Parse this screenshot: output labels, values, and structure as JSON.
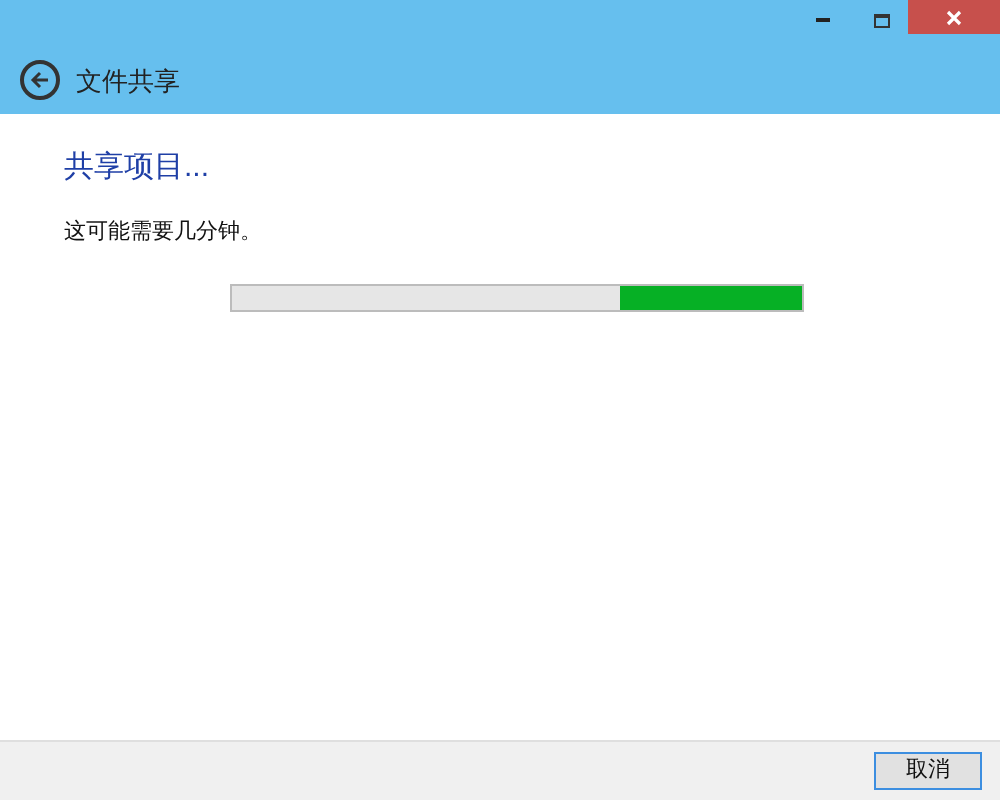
{
  "window": {
    "title": "文件共享"
  },
  "heading": "共享项目...",
  "message": "这可能需要几分钟。",
  "progress": {
    "level": 0.32
  },
  "buttons": [
    "取消"
  ]
}
